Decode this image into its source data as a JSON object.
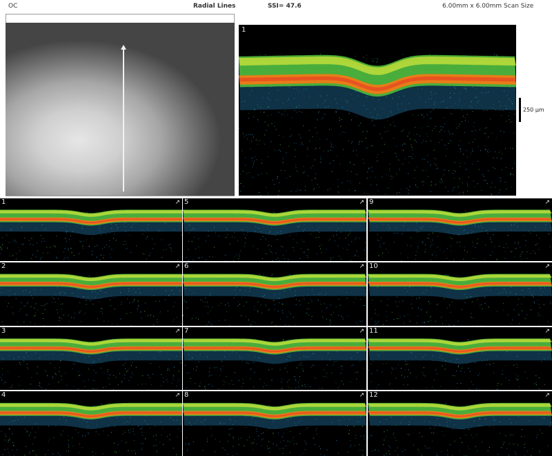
{
  "header": {
    "eye": "OC",
    "scan_pattern": "Radial Lines",
    "ssi": "SSI= 47.6",
    "scan_size": "6.00mm x 6.00mm Scan Size"
  },
  "colors": {
    "background": "#000000",
    "rpe": "#f07a16",
    "retina": "#54c33a",
    "noise": "#2b8fc9"
  },
  "fundus": {
    "icon": "scan-direction-arrow"
  },
  "main_scan": {
    "number": "1",
    "scale_label": "250 µm"
  },
  "tiles": [
    {
      "number": "1"
    },
    {
      "number": "5"
    },
    {
      "number": "9"
    },
    {
      "number": "2"
    },
    {
      "number": "6"
    },
    {
      "number": "10"
    },
    {
      "number": "3"
    },
    {
      "number": "7"
    },
    {
      "number": "11"
    },
    {
      "number": "4"
    },
    {
      "number": "8"
    },
    {
      "number": "12"
    }
  ]
}
